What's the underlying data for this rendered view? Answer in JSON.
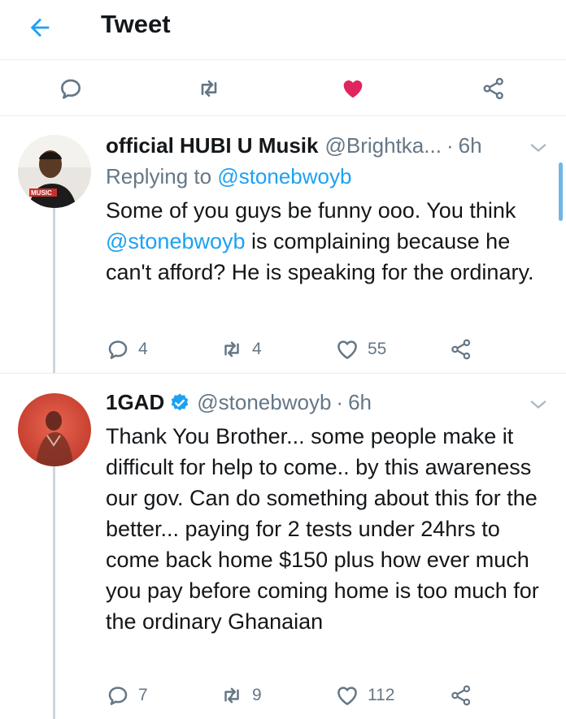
{
  "header": {
    "title": "Tweet",
    "back_icon": "arrow-left-icon"
  },
  "top_actions": {
    "reply_icon": "reply-icon",
    "retweet_icon": "retweet-icon",
    "like_icon": "heart-filled-icon",
    "share_icon": "share-icon",
    "like_color": "#e0245e",
    "accent": "#1da1f2"
  },
  "tweets": [
    {
      "name": "official HUBI U Musik",
      "handle": "@Brightka...",
      "separator": "·",
      "time": "6h",
      "replying_prefix": "Replying to",
      "replying_to": "@stonebwoyb",
      "text_line1": "Some of you guys be funny ooo. You think",
      "text_mention": "@stonebwoyb",
      "text_rest": " is complaining because he can't afford? He is speaking for the ordinary.",
      "avatar_badge": "MUSIC",
      "replies": "4",
      "retweets": "4",
      "likes": "55"
    },
    {
      "name": "1GAD",
      "handle": "@stonebwoyb",
      "separator": "·",
      "time": "6h",
      "text": "Thank You Brother... some people make it difficult for help to come.. by this awareness our gov. Can do something about this for the better... paying for 2 tests under 24hrs to come back home $150 plus how ever much you pay before coming home is too much for the ordinary Ghanaian",
      "replies": "7",
      "retweets": "9",
      "likes": "112"
    }
  ]
}
